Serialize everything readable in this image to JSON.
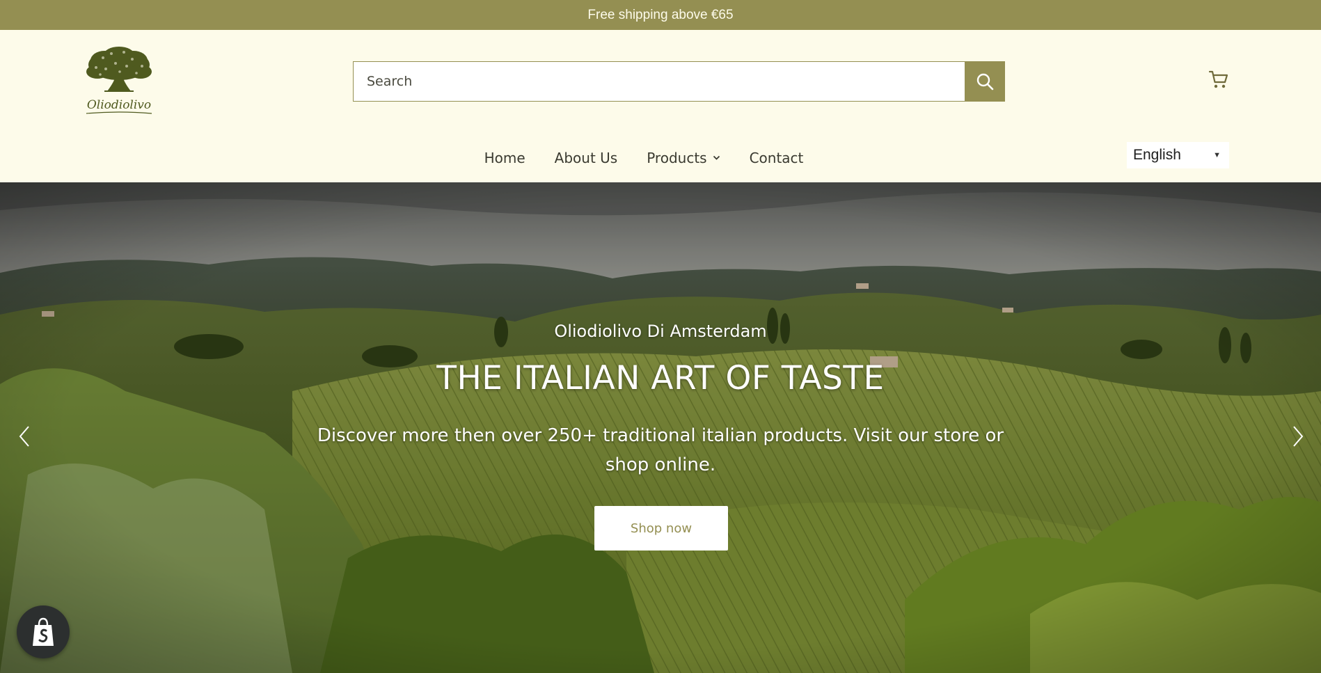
{
  "announcement": {
    "text": "Free shipping above €65"
  },
  "header": {
    "logo_name": "Oliodiolivo",
    "search": {
      "placeholder": "Search",
      "value": ""
    },
    "nav": {
      "items": [
        {
          "label": "Home"
        },
        {
          "label": "About Us"
        },
        {
          "label": "Products",
          "has_dropdown": true
        },
        {
          "label": "Contact"
        }
      ]
    },
    "language": {
      "selected": "English"
    }
  },
  "hero": {
    "subtitle": "Oliodiolivo Di Amsterdam",
    "title": "THE ITALIAN ART OF TASTE",
    "text": "Discover more then over 250+ traditional italian products. Visit our store or shop online.",
    "cta_label": "Shop now"
  },
  "colors": {
    "brand": "#948f52",
    "header_bg": "#fdfbea",
    "text": "#3a3a30"
  },
  "icons": {
    "search": "search-icon",
    "cart": "cart-icon",
    "chevron": "chevron-down-icon",
    "prev": "chevron-left-icon",
    "next": "chevron-right-icon",
    "shopify": "shopify-bag-icon"
  }
}
